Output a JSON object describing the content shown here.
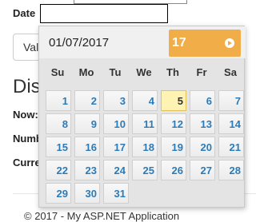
{
  "form": {
    "date_label": "Date",
    "date_value": "",
    "validate_label": "Validate"
  },
  "page": {
    "heading": "Dis",
    "now_label": "Now:",
    "number_label": "Numb",
    "current_label": "Curre",
    "footer": "© 2017 - My ASP.NET Application"
  },
  "datepicker": {
    "selected_text": "01/07/2017",
    "header_year": "17",
    "next_icon": "next-circle-arrow",
    "weekdays": [
      "Su",
      "Mo",
      "Tu",
      "We",
      "Th",
      "Fr",
      "Sa"
    ],
    "weeks": [
      [
        null,
        "1",
        "2",
        "3",
        "4",
        "5",
        "6",
        "7"
      ],
      [
        "8",
        "9",
        "10",
        "11",
        "12",
        "13",
        "14"
      ],
      [
        "15",
        "16",
        "17",
        "18",
        "19",
        "20",
        "21"
      ],
      [
        "22",
        "23",
        "24",
        "25",
        "26",
        "27",
        "28"
      ],
      [
        "29",
        "30",
        "31"
      ]
    ],
    "today": "5",
    "colors": {
      "header": "#f1ae48",
      "day_text": "#2b7bb9",
      "today_bg": "#fff3b3"
    }
  }
}
